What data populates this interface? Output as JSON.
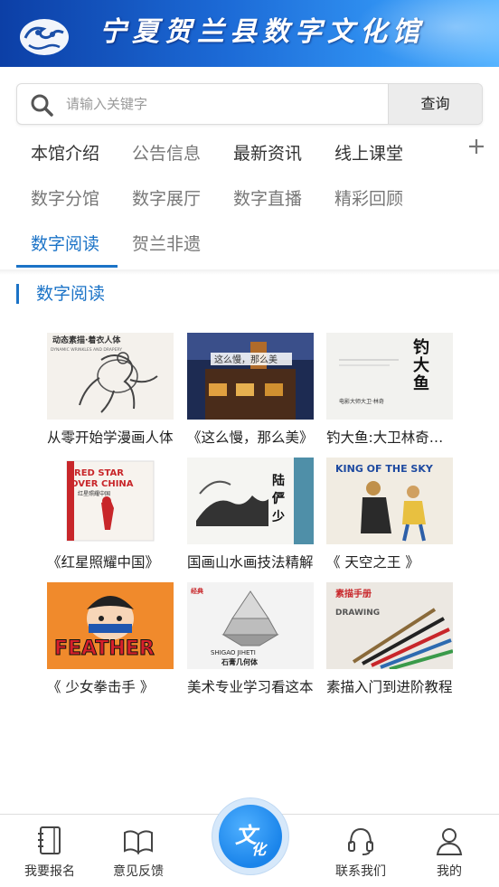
{
  "banner": {
    "title": "宁夏贺兰县数字文化馆",
    "logo_icon": "auspicious-cloud-logo-icon",
    "colors": {
      "from": "#0c3fa6",
      "to": "#57b4ff"
    }
  },
  "search": {
    "placeholder": "请输入关键字",
    "value": "",
    "button_label": "查询",
    "icon": "search-icon"
  },
  "nav": {
    "rows": [
      [
        "本馆介绍",
        "公告信息",
        "最新资讯",
        "线上课堂"
      ],
      [
        "数字分馆",
        "数字展厅",
        "数字直播",
        "精彩回顾"
      ],
      [
        "数字阅读",
        "贺兰非遗"
      ]
    ],
    "active": "数字阅读",
    "more_icon": "plus-icon",
    "accent_color": "#1b73c7"
  },
  "section": {
    "title": "数字阅读"
  },
  "books": [
    {
      "title": "从零开始学漫画人体",
      "cover_text": "动态素描·着衣人体",
      "cover_sub": "DYNAMIC WRINKLES AND DRAPERY"
    },
    {
      "title": "《这么慢，那么美》",
      "cover_text": "这么慢，那么美",
      "cover_sub": ""
    },
    {
      "title": "钓大鱼:大卫林奇谈创意",
      "cover_text": "钓大鱼",
      "cover_sub": "电影大师大卫·林奇"
    },
    {
      "title": "《红星照耀中国》",
      "cover_text": "RED STAR OVER CHINA",
      "cover_sub": "红星照耀中国"
    },
    {
      "title": "国画山水画技法精解",
      "cover_text": "陆俨少",
      "cover_sub": ""
    },
    {
      "title": "《 天空之王 》",
      "cover_text": "KING OF THE SKY",
      "cover_sub": ""
    },
    {
      "title": "《 少女拳击手 》",
      "cover_text": "FEATHER",
      "cover_sub": ""
    },
    {
      "title": "美术专业学习看这本",
      "cover_text": "石膏几何体",
      "cover_sub": "SHIGAO JIHETI"
    },
    {
      "title": "素描入门到进阶教程",
      "cover_text": "素描手册",
      "cover_sub": "DRAWING"
    }
  ],
  "tabbar": {
    "items": [
      {
        "label": "我要报名",
        "icon": "notebook-icon"
      },
      {
        "label": "意见反馈",
        "icon": "open-book-icon"
      },
      {
        "label": "联系我们",
        "icon": "headset-icon"
      },
      {
        "label": "我的",
        "icon": "user-icon"
      }
    ],
    "center": {
      "glyph_top": "文",
      "glyph_bottom": "化",
      "icon": "culture-center-icon"
    }
  }
}
